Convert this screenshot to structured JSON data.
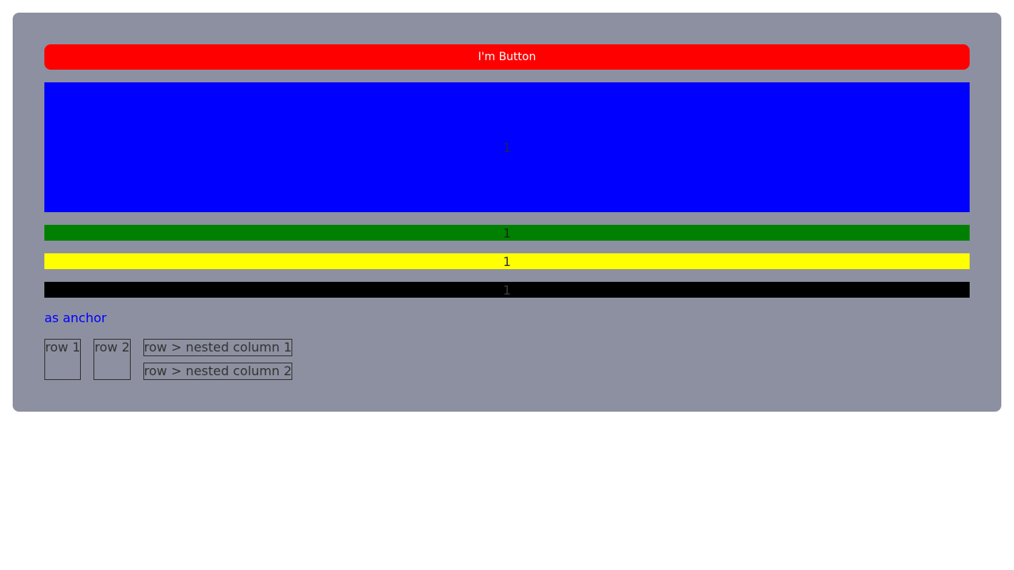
{
  "button": {
    "label": "I'm Button"
  },
  "bars": [
    {
      "label": "1",
      "color": "#0000ff"
    },
    {
      "label": "1",
      "color": "#008000"
    },
    {
      "label": "1",
      "color": "#ffff00"
    },
    {
      "label": "1",
      "color": "#000000"
    }
  ],
  "anchor": {
    "label": "as anchor",
    "color": "#0000ff"
  },
  "rows": {
    "row1": "row 1",
    "row2": "row 2",
    "nested": [
      "row > nested column 1",
      "row > nested column 2"
    ]
  },
  "colors": {
    "panel": "#8d90a0",
    "button": "#ff0000"
  }
}
